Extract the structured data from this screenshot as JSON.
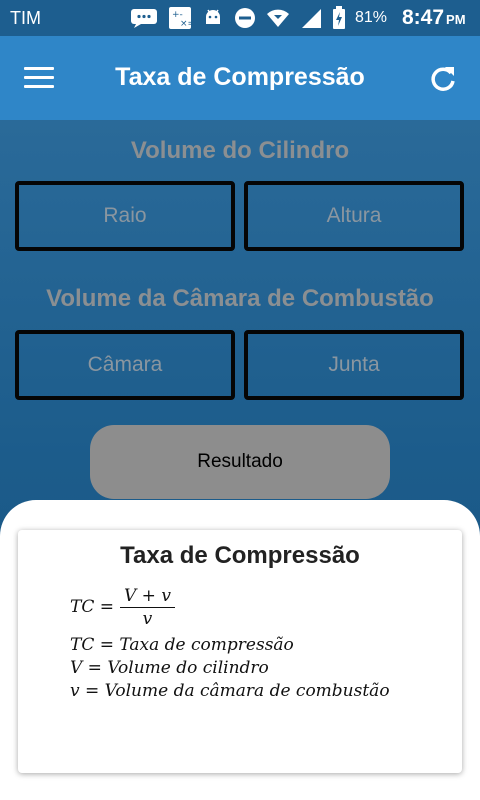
{
  "status_bar": {
    "carrier": "TIM",
    "battery_percent": "81%",
    "time": "8:47",
    "ampm": "PM"
  },
  "app_bar": {
    "title": "Taxa de Compressão",
    "menu_icon": "hamburger-menu-icon",
    "refresh_icon": "refresh-icon",
    "color": "#2f86c8"
  },
  "cylinder": {
    "title": "Volume do Cilindro",
    "raio_placeholder": "Raio",
    "altura_placeholder": "Altura"
  },
  "chamber": {
    "title": "Volume da Câmara de Combustão",
    "camara_placeholder": "Câmara",
    "junta_placeholder": "Junta"
  },
  "result_button": {
    "label": "Resultado"
  },
  "info_card": {
    "title": "Taxa de Compressão",
    "formula_lhs": "TC =",
    "numerator": "V + v",
    "denominator": "v",
    "definitions": [
      "TC = Taxa de compressão",
      "V = Volume do cilindro",
      "v = Volume da câmara de combustão"
    ]
  }
}
